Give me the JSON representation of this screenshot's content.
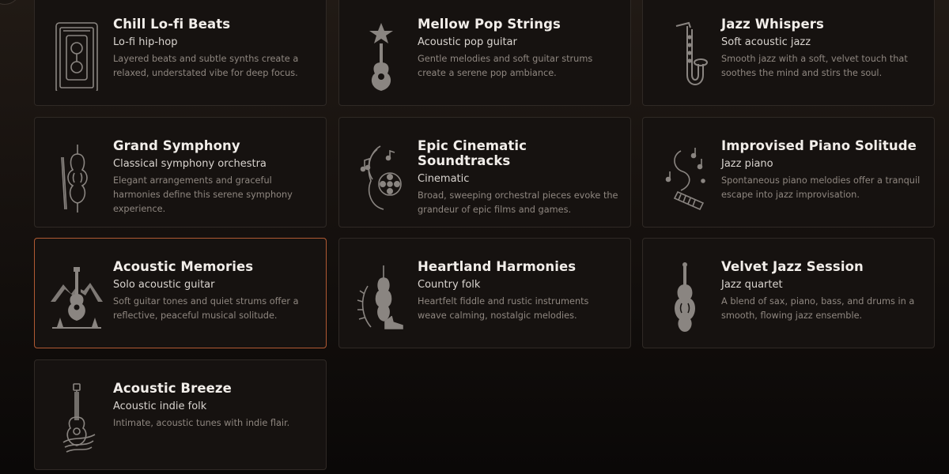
{
  "colors": {
    "accent_border": "#b15a33",
    "card_bg": "#161210",
    "icon": "#8a8581"
  },
  "cards": [
    {
      "title": "Chill Lo-fi Beats",
      "subtitle": "Lo-fi hip-hop",
      "description": "Layered beats and subtle synths create a relaxed, understated vibe for deep focus.",
      "icon": "cassette-icon",
      "selected": false
    },
    {
      "title": "Mellow Pop Strings",
      "subtitle": "Acoustic pop guitar",
      "description": "Gentle melodies and soft guitar strums create a serene pop ambiance.",
      "icon": "star-guitar-icon",
      "selected": false
    },
    {
      "title": "Jazz Whispers",
      "subtitle": "Soft acoustic jazz",
      "description": "Smooth jazz with a soft, velvet touch that soothes the mind and stirs the soul.",
      "icon": "saxophone-icon",
      "selected": false
    },
    {
      "title": "Grand Symphony",
      "subtitle": "Classical symphony orchestra",
      "description": "Elegant arrangements and graceful harmonies define this serene symphony experience.",
      "icon": "violin-icon",
      "selected": false
    },
    {
      "title": "Epic Cinematic Soundtracks",
      "subtitle": "Cinematic",
      "description": "Broad, sweeping orchestral pieces evoke the grandeur of epic films and games.",
      "icon": "film-reel-icon",
      "selected": false
    },
    {
      "title": "Improvised Piano Solitude",
      "subtitle": "Jazz piano",
      "description": "Spontaneous piano melodies offer a tranquil escape into jazz improvisation.",
      "icon": "piano-notes-icon",
      "selected": false
    },
    {
      "title": "Acoustic Memories",
      "subtitle": "Solo acoustic guitar",
      "description": "Soft guitar tones and quiet strums offer a reflective, peaceful musical solitude.",
      "icon": "mountain-guitar-icon",
      "selected": true
    },
    {
      "title": "Heartland Harmonies",
      "subtitle": "Country folk",
      "description": "Heartfelt fiddle and rustic instruments weave calming, nostalgic melodies.",
      "icon": "fiddle-boot-icon",
      "selected": false
    },
    {
      "title": "Velvet Jazz Session",
      "subtitle": "Jazz quartet",
      "description": "A blend of sax, piano, bass, and drums in a smooth, flowing jazz ensemble.",
      "icon": "double-bass-icon",
      "selected": false
    },
    {
      "title": "Acoustic Breeze",
      "subtitle": "Acoustic indie folk",
      "description": "Intimate, acoustic tunes with indie flair.",
      "icon": "ribbon-guitar-icon",
      "selected": false
    }
  ]
}
